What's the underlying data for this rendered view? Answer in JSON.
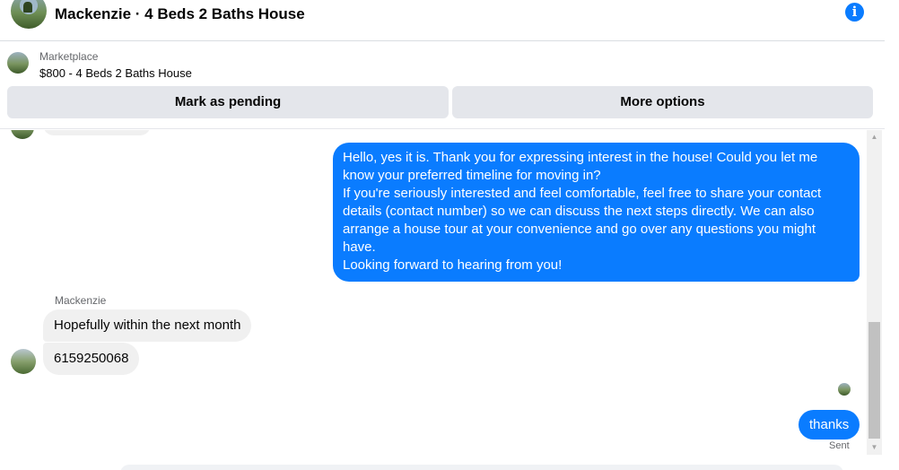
{
  "header": {
    "title": "Mackenzie · 4 Beds 2 Baths House",
    "info_icon": "i"
  },
  "context": {
    "label": "Marketplace",
    "item": "$800 - 4 Beds 2 Baths House",
    "buttons": {
      "pending": "Mark as pending",
      "more": "More options"
    }
  },
  "messages": {
    "outgoing_long": [
      "Hello, yes it is. Thank you for expressing interest in the house! Could you let me know your preferred timeline for moving in?",
      "If you're seriously interested and feel comfortable, feel free to share your contact details (contact number) so we can discuss the next steps directly. We can also arrange a house tour at your convenience and go over any questions you might have.",
      "Looking forward to hearing from you!"
    ],
    "sender_name": "Mackenzie",
    "incoming": [
      "Hopefully within the next month",
      "6159250068"
    ],
    "outgoing_short": "thanks",
    "status": "Sent"
  },
  "colors": {
    "accent": "#0a7cff",
    "incoming_bubble": "#f0f0f0",
    "button_bg": "#e4e6eb"
  }
}
